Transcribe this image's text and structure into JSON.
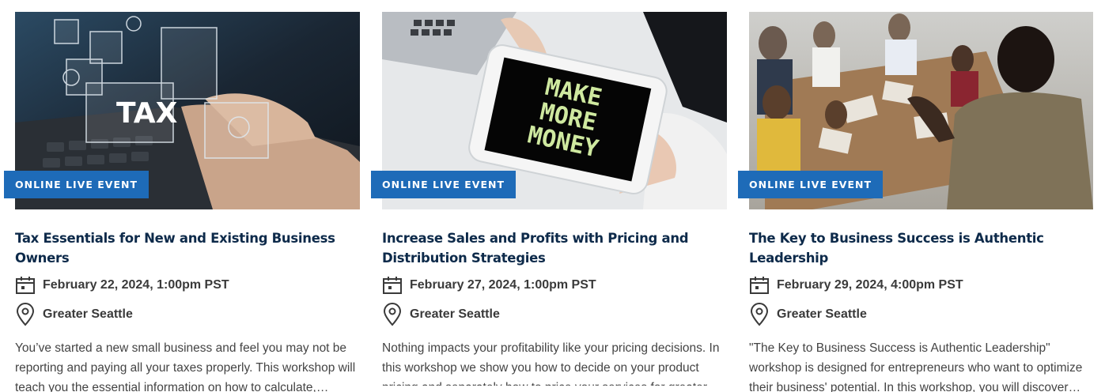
{
  "events": [
    {
      "badge": "ONLINE LIVE EVENT",
      "title": "Tax Essentials for New and Existing Business Owners",
      "date": "February 22, 2024, 1:00pm PST",
      "location": "Greater Seattle",
      "description": "You’ve started a new small business and feel you may not be reporting and paying all your taxes properly. This workshop will teach you the essential information on how to calculate,…",
      "image_text": "TAX"
    },
    {
      "badge": "ONLINE LIVE EVENT",
      "title": "Increase Sales and Profits with Pricing and Distribution Strategies",
      "date": "February 27, 2024, 1:00pm PST",
      "location": "Greater Seattle",
      "description": "Nothing impacts your profitability like your pricing decisions. In this workshop we show you how to decide on your product pricing and separately how to price your services for greater…",
      "image_text_lines": [
        "MAKE",
        "MORE",
        "MONEY"
      ]
    },
    {
      "badge": "ONLINE LIVE EVENT",
      "title": "The Key to Business Success is Authentic Leadership",
      "date": "February 29, 2024, 4:00pm PST",
      "location": "Greater Seattle",
      "description": "\"The Key to Business Success is Authentic Leadership\" workshop is designed for entrepreneurs who want to optimize their business' potential. In this workshop, you will discover…"
    }
  ],
  "colors": {
    "badge_bg": "#1e6bb8",
    "title": "#0d2a4a",
    "text": "#444444"
  }
}
